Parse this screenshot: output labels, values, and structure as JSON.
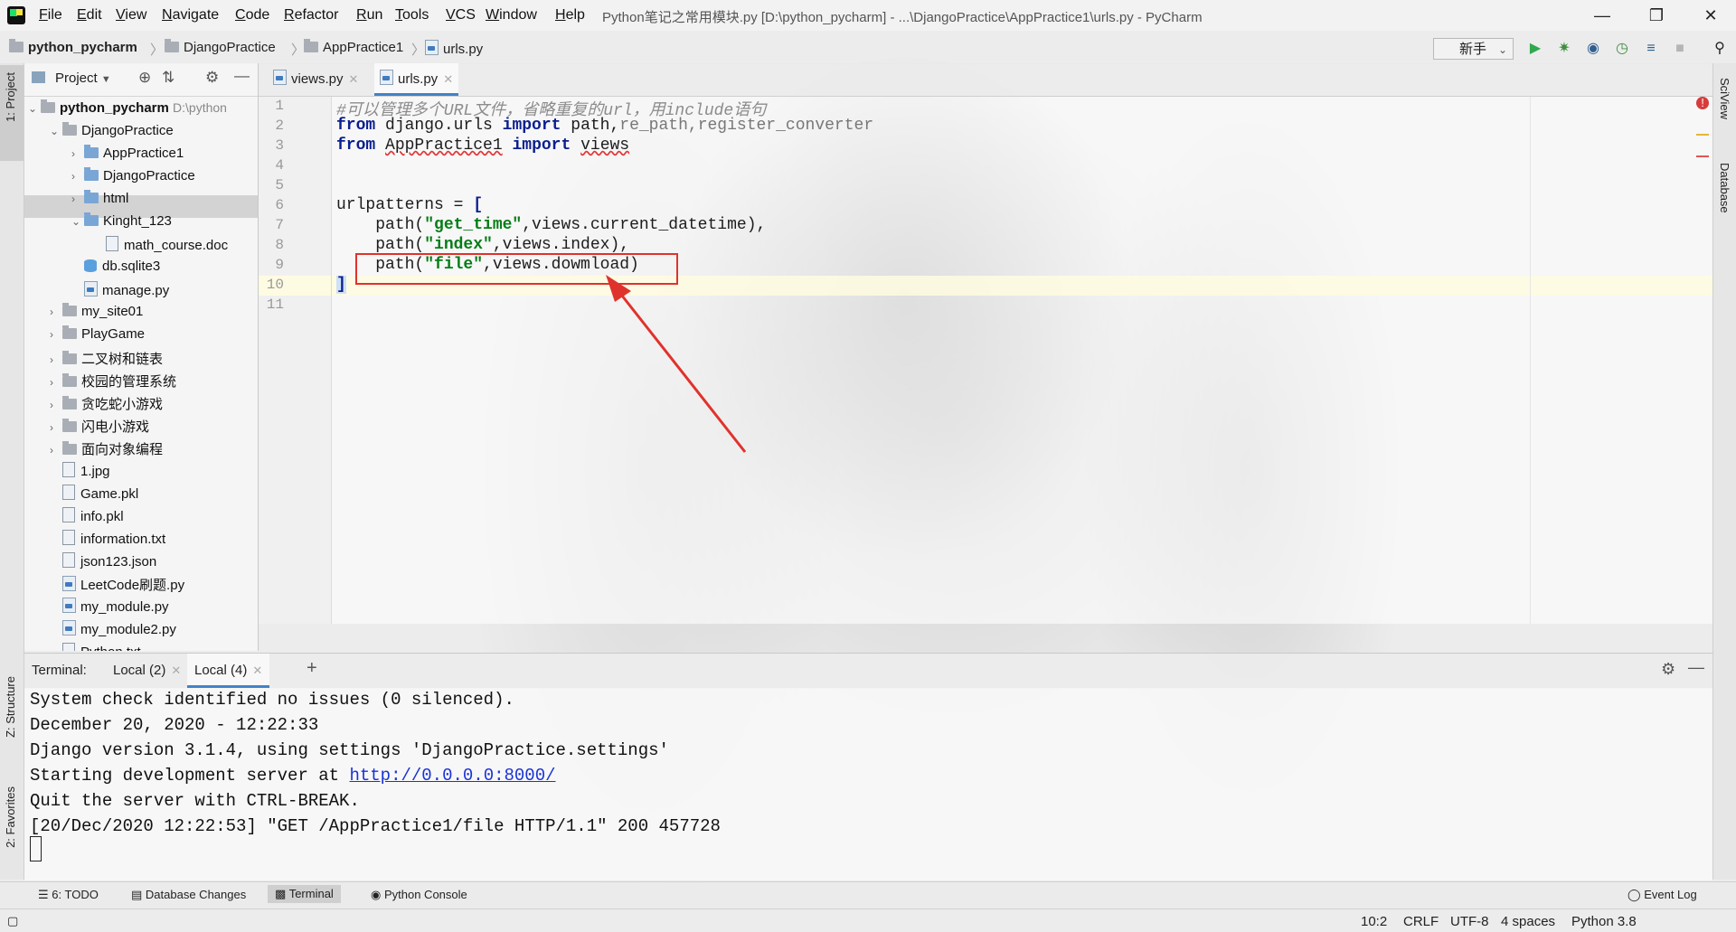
{
  "window": {
    "title": "Python笔记之常用模块.py [D:\\python_pycharm] - ...\\DjangoPractice\\AppPractice1\\urls.py - PyCharm"
  },
  "menu": [
    "File",
    "Edit",
    "View",
    "Navigate",
    "Code",
    "Refactor",
    "Run",
    "Tools",
    "VCS",
    "Window",
    "Help"
  ],
  "breadcrumb": [
    "python_pycharm",
    "DjangoPractice",
    "AppPractice1",
    "urls.py"
  ],
  "run_config": "新手",
  "left_tabs": {
    "project": "1: Project",
    "structure": "Z: Structure",
    "favorites": "2: Favorites"
  },
  "right_tabs": {
    "sciview": "SciView",
    "database": "Database"
  },
  "project_panel": {
    "title": "Project",
    "root": {
      "name": "python_pycharm",
      "path": "D:\\python"
    },
    "items": [
      {
        "label": "DjangoPractice",
        "type": "folder",
        "level": 1,
        "expanded": true
      },
      {
        "label": "AppPractice1",
        "type": "folder",
        "level": 2
      },
      {
        "label": "DjangoPractice",
        "type": "folder",
        "level": 2
      },
      {
        "label": "html",
        "type": "folder",
        "level": 2
      },
      {
        "label": "Kinght_123",
        "type": "folder",
        "level": 2,
        "expanded": true
      },
      {
        "label": "math_course.doc",
        "type": "file",
        "level": 3,
        "selected": true
      },
      {
        "label": "db.sqlite3",
        "type": "db",
        "level": 2
      },
      {
        "label": "manage.py",
        "type": "py",
        "level": 2
      },
      {
        "label": "my_site01",
        "type": "folder",
        "level": 1
      },
      {
        "label": "PlayGame",
        "type": "folder",
        "level": 1
      },
      {
        "label": "二叉树和链表",
        "type": "folder",
        "level": 1
      },
      {
        "label": "校园的管理系统",
        "type": "folder",
        "level": 1
      },
      {
        "label": "贪吃蛇小游戏",
        "type": "folder",
        "level": 1
      },
      {
        "label": "闪电小游戏",
        "type": "folder",
        "level": 1
      },
      {
        "label": "面向对象编程",
        "type": "folder",
        "level": 1
      },
      {
        "label": "1.jpg",
        "type": "file",
        "level": 1
      },
      {
        "label": "Game.pkl",
        "type": "file",
        "level": 1
      },
      {
        "label": "info.pkl",
        "type": "file",
        "level": 1
      },
      {
        "label": "information.txt",
        "type": "file",
        "level": 1
      },
      {
        "label": "json123.json",
        "type": "file",
        "level": 1
      },
      {
        "label": "LeetCode刷题.py",
        "type": "py",
        "level": 1
      },
      {
        "label": "my_module.py",
        "type": "py",
        "level": 1
      },
      {
        "label": "my_module2.py",
        "type": "py",
        "level": 1
      },
      {
        "label": "Python.txt",
        "type": "file",
        "level": 1
      }
    ]
  },
  "editor": {
    "tabs": [
      {
        "label": "views.py",
        "active": false
      },
      {
        "label": "urls.py",
        "active": true
      }
    ],
    "line_numbers": [
      "1",
      "2",
      "3",
      "4",
      "5",
      "6",
      "7",
      "8",
      "9",
      "10",
      "11"
    ],
    "lines": {
      "l1": "#可以管理多个URL文件，省略重复的url，用include语句",
      "l2_kw1": "from",
      "l2_mod": " django.urls ",
      "l2_kw2": "import",
      "l2_used": " path,",
      "l2_unused": "re_path,register_converter",
      "l3_kw1": "from",
      "l3_mod": "AppPractice1",
      "l3_kw2": "import",
      "l3_name": "views",
      "l6_a": "urlpatterns = ",
      "l6_b": "[",
      "l7_a": "    path(",
      "l7_s": "\"get_time\"",
      "l7_b": ",views.current_datetime),",
      "l8_a": "    path(",
      "l8_s": "\"index\"",
      "l8_b": ",views.index),",
      "l9_a": "    path(",
      "l9_s": "\"file\"",
      "l9_b": ",views.dowmload)",
      "l10": "]"
    }
  },
  "terminal": {
    "label": "Terminal:",
    "tabs": [
      "Local (2)",
      "Local (4)"
    ],
    "lines": [
      "System check identified no issues (0 silenced).",
      "December 20, 2020 - 12:22:33",
      "Django version 3.1.4, using settings 'DjangoPractice.settings'"
    ],
    "server_prefix": "Starting development server at ",
    "server_url": "http://0.0.0.0:8000/",
    "lines2": [
      "Quit the server with CTRL-BREAK.",
      "[20/Dec/2020 12:22:53] \"GET /AppPractice1/file HTTP/1.1\" 200 457728"
    ]
  },
  "tool_windows": {
    "todo": "6: TODO",
    "db_changes": "Database Changes",
    "terminal": "Terminal",
    "python_console": "Python Console",
    "event_log": "Event Log"
  },
  "status": {
    "position": "10:2",
    "line_sep": "CRLF",
    "encoding": "UTF-8",
    "indent": "4 spaces",
    "interpreter": "Python 3.8"
  },
  "colors": {
    "keyword": "#0b1f8e",
    "string": "#067d17",
    "comment": "#8c8c8c",
    "highlight_box": "#e0322c",
    "link": "#1a33d6"
  }
}
